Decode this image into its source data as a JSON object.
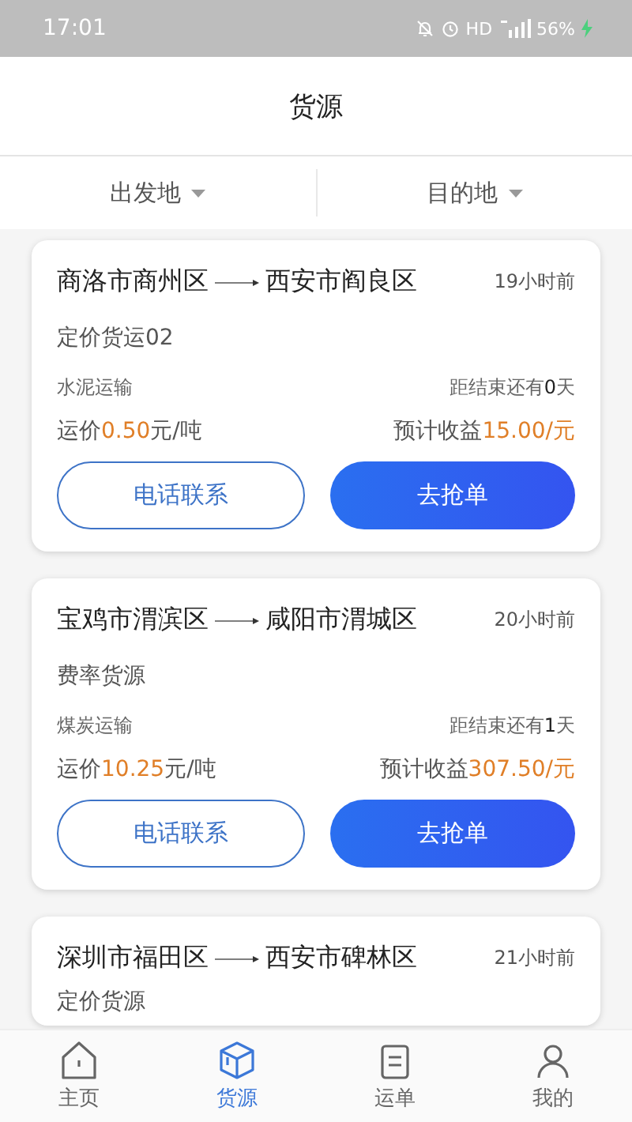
{
  "status_bar": {
    "time": "17:01",
    "network": "HD",
    "battery": "56%"
  },
  "header": {
    "title": "货源"
  },
  "filters": [
    {
      "label": "出发地"
    },
    {
      "label": "目的地"
    }
  ],
  "cards": [
    {
      "from": "商洛市商州区",
      "to": "西安市阎良区",
      "time": "19小时前",
      "title": "定价货运02",
      "cargo": "水泥运输",
      "deadline": "距结束还有**0**天",
      "price": {
        "label": "运价",
        "value": "0.50",
        "unit": "元/吨"
      },
      "income": {
        "label": "预计收益",
        "value": "15.00/元"
      },
      "buttons": [
        "电话联系",
        "去抢单"
      ]
    },
    {
      "from": "宝鸡市渭滨区",
      "to": "咸阳市渭城区",
      "time": "20小时前",
      "title": "费率货源",
      "cargo": "煤炭运输",
      "deadline": "距结束还有**1**天",
      "price": {
        "label": "运价",
        "value": "10.25",
        "unit": "元/吨"
      },
      "income": {
        "label": "预计收益",
        "value": "307.50/元"
      },
      "buttons": [
        "电话联系",
        "去抢单"
      ]
    },
    {
      "from": "深圳市福田区",
      "to": "西安市碑林区",
      "time": "21小时前",
      "title": "定价货源"
    }
  ],
  "tab_bar": [
    {
      "label": "主页",
      "kind": "home",
      "selected": false
    },
    {
      "label": "货源",
      "kind": "box",
      "selected": true
    },
    {
      "label": "运单",
      "kind": "list",
      "selected": false
    },
    {
      "label": "我的",
      "kind": "person",
      "selected": false
    }
  ]
}
